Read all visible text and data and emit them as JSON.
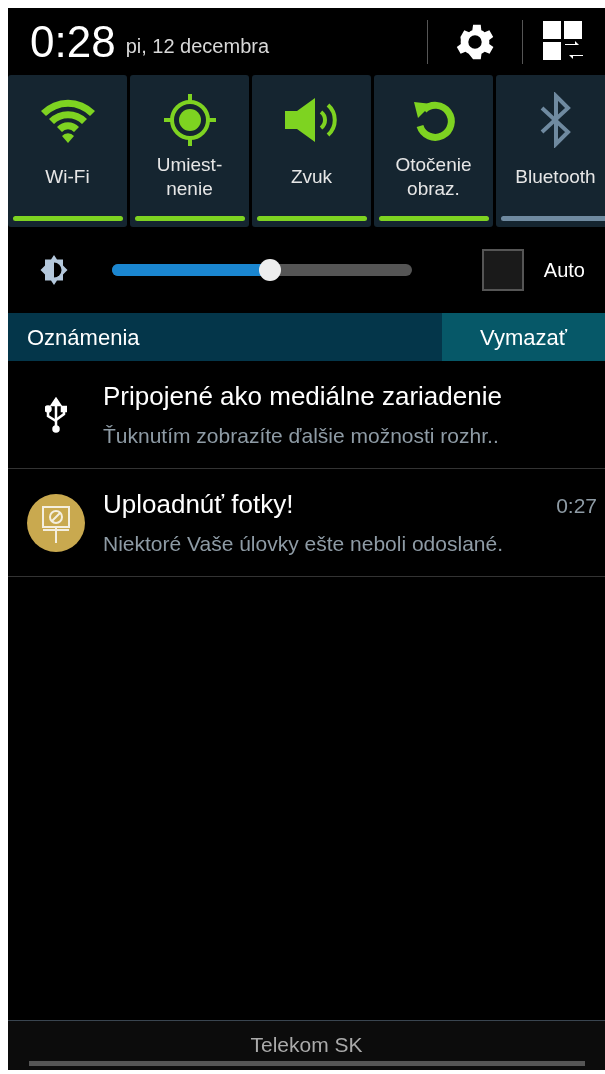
{
  "header": {
    "time": "0:28",
    "date": "pi, 12 decembra"
  },
  "toggles": [
    {
      "kind": "wifi",
      "label": "Wi-Fi",
      "on": true
    },
    {
      "kind": "location",
      "label": "Umiest-\nnenie",
      "on": true
    },
    {
      "kind": "sound",
      "label": "Zvuk",
      "on": true
    },
    {
      "kind": "rotation",
      "label": "Otočenie\nobraz.",
      "on": true
    },
    {
      "kind": "bluetooth",
      "label": "Bluetooth",
      "on": false
    }
  ],
  "brightness": {
    "level": 0.53,
    "auto_label": "Auto",
    "auto_checked": false
  },
  "notifications_header": {
    "title": "Oznámenia",
    "clear_button": "Vymazať"
  },
  "notifications": [
    {
      "kind": "usb",
      "title": "Pripojené ako mediálne zariadenie",
      "text": "Ťuknutím zobrazíte ďalšie možnosti rozhr.."
    },
    {
      "kind": "app",
      "title": "Uploadnúť fotky!",
      "time": "0:27",
      "text": "Niektoré Vaše úlovky ešte neboli odoslané."
    }
  ],
  "carrier": "Telekom SK"
}
